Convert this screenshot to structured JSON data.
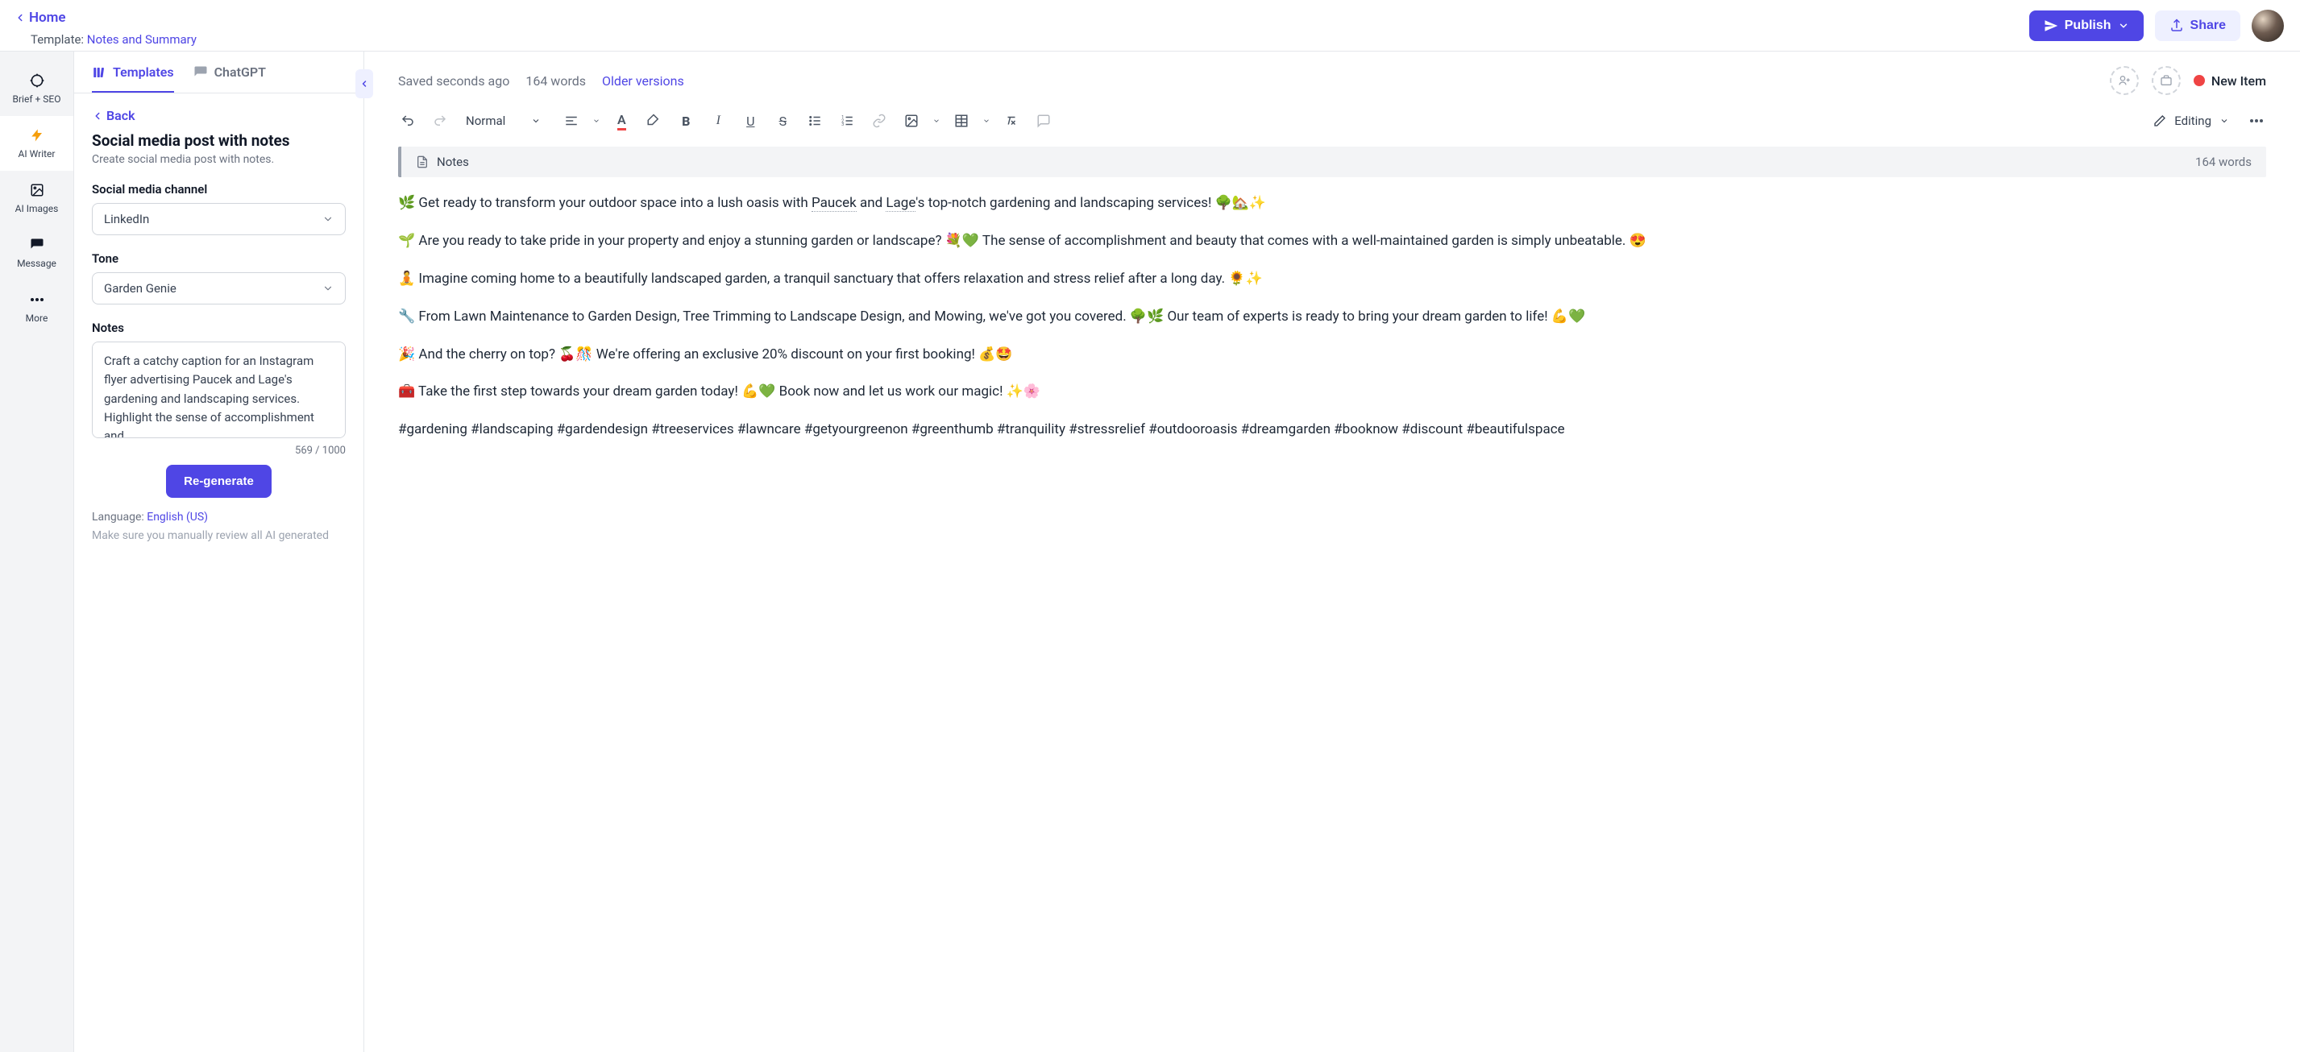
{
  "header": {
    "home": "Home",
    "template_prefix": "Template: ",
    "template_name": "Notes and Summary",
    "publish": "Publish",
    "share": "Share"
  },
  "rail": {
    "brief": "Brief + SEO",
    "writer": "AI Writer",
    "images": "AI Images",
    "message": "Message",
    "more": "More"
  },
  "sidebar": {
    "tab_templates": "Templates",
    "tab_chatgpt": "ChatGPT",
    "back": "Back",
    "title": "Social media post with notes",
    "desc": "Create social media post with notes.",
    "channel_label": "Social media channel",
    "channel_value": "LinkedIn",
    "tone_label": "Tone",
    "tone_value": "Garden Genie",
    "notes_label": "Notes",
    "notes_value": "Craft a catchy caption for an Instagram flyer advertising Paucek and Lage's gardening and landscaping services. Highlight the sense of accomplishment and",
    "char_count": "569 / 1000",
    "regen": "Re-generate",
    "lang_prefix": "Language: ",
    "lang_value": "English (US)",
    "disclaimer": "Make sure you manually review all AI generated"
  },
  "editor": {
    "saved": "Saved seconds ago",
    "wc": "164 words",
    "older": "Older versions",
    "new_item": "New Item",
    "style_normal": "Normal",
    "mode": "Editing",
    "notes_label": "Notes",
    "notes_wc": "164 words",
    "p1a": "🌿 Get ready to transform your outdoor space into a lush oasis with ",
    "p1_m1": "Paucek",
    "p1b": " and ",
    "p1_m2": "Lage",
    "p1c": "'s top-notch gardening and landscaping services! 🌳🏡✨",
    "p2": "🌱 Are you ready to take pride in your property and enjoy a stunning garden or landscape? 💐💚 The sense of accomplishment and beauty that comes with a well-maintained garden is simply unbeatable. 😍",
    "p3": "🧘 Imagine coming home to a beautifully landscaped garden, a tranquil sanctuary that offers relaxation and stress relief after a long day. 🌻✨",
    "p4": "🔧 From Lawn Maintenance to Garden Design, Tree Trimming to Landscape Design, and Mowing, we've got you covered. 🌳🌿 Our team of experts is ready to bring your dream garden to life! 💪💚",
    "p5": "🎉 And the cherry on top? 🍒🎊 We're offering an exclusive 20% discount on your first booking! 💰🤩",
    "p6": "🧰 Take the first step towards your dream garden today! 💪💚 Book now and let us work our magic! ✨🌸",
    "p7": "#gardening #landscaping #gardendesign #treeservices #lawncare #getyourgreenon #greenthumb #tranquility #stressrelief #outdooroasis #dreamgarden #booknow #discount #beautifulspace"
  }
}
